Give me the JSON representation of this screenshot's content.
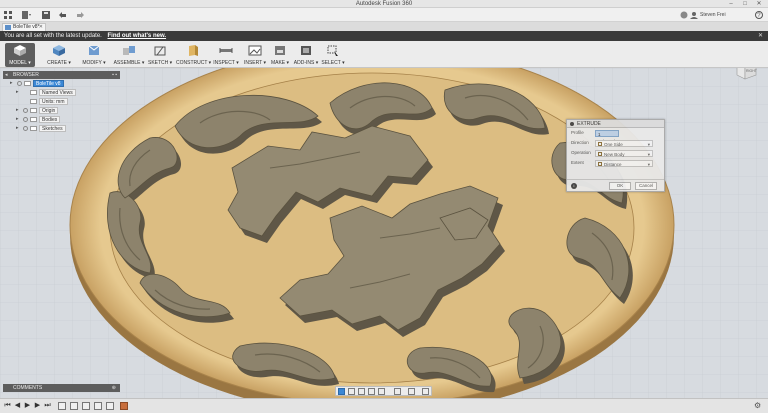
{
  "app": {
    "title": "Autodesk Fusion 360",
    "user": "Steven Frei",
    "window_controls": [
      "–",
      "□",
      "✕"
    ]
  },
  "document": {
    "tab_label": "BoleTile v8*"
  },
  "notification": {
    "text": "You are all set with the latest update.",
    "link": "Find out what's new.",
    "close": "✕"
  },
  "toolbar": {
    "workspace": "MODEL ▾",
    "tools": [
      {
        "label": "CREATE ▾",
        "icon": "create-box-icon"
      },
      {
        "label": "MODIFY ▾",
        "icon": "modify-icon"
      },
      {
        "label": "ASSEMBLE ▾",
        "icon": "assemble-icon"
      },
      {
        "label": "SKETCH ▾",
        "icon": "sketch-icon"
      },
      {
        "label": "CONSTRUCT ▾",
        "icon": "construct-icon"
      },
      {
        "label": "INSPECT ▾",
        "icon": "inspect-icon"
      },
      {
        "label": "INSERT ▾",
        "icon": "insert-icon"
      },
      {
        "label": "MAKE ▾",
        "icon": "make-icon"
      },
      {
        "label": "ADD-INS ▾",
        "icon": "add-ins-icon"
      },
      {
        "label": "SELECT ▾",
        "icon": "select-icon"
      }
    ]
  },
  "browser": {
    "title": "BROWSER",
    "items": [
      {
        "label": "BoleTile v8",
        "selected": true,
        "has_arrow": true
      },
      {
        "label": "Named Views",
        "selected": false,
        "has_arrow": true
      },
      {
        "label": "Units: mm",
        "selected": false,
        "has_arrow": false
      },
      {
        "label": "Origin",
        "selected": false,
        "has_arrow": true
      },
      {
        "label": "Bodies",
        "selected": false,
        "has_arrow": true
      },
      {
        "label": "Sketches",
        "selected": false,
        "has_arrow": true
      }
    ]
  },
  "extrude": {
    "title": "EXTRUDE",
    "rows": [
      {
        "label": "Profile",
        "value": "1 selected",
        "kind": "selection"
      },
      {
        "label": "Direction",
        "value": "One Side",
        "kind": "combo"
      },
      {
        "label": "Operation",
        "value": "New Body",
        "kind": "combo"
      },
      {
        "label": "Extent",
        "value": "Distance",
        "kind": "combo"
      }
    ],
    "ok": "OK",
    "cancel": "Cancel"
  },
  "viewcube": {
    "face": "RIGHT"
  },
  "comments": {
    "title": "COMMENTS"
  },
  "colors": {
    "accent": "#3b88d6",
    "tile_base": "#e2c68c",
    "tile_rim": "#b98f4e",
    "relief_top": "#8d836c",
    "relief_side": "#5f5747",
    "notification_bg": "#3a3a3a",
    "panel_header": "#5d5d5d"
  }
}
